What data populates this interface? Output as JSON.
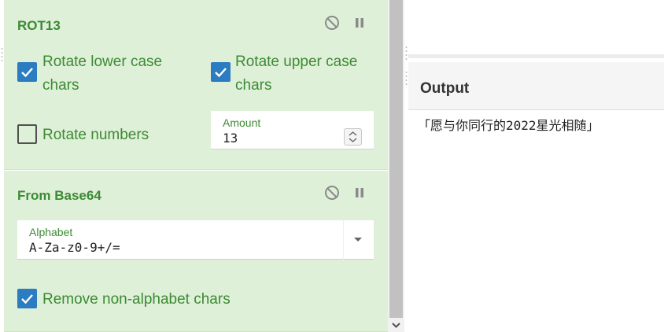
{
  "recipe": {
    "rot13": {
      "title": "ROT13",
      "rotate_lower_label": "Rotate lower case chars",
      "rotate_lower_line1": "Rotate lower case",
      "rotate_lower_line2": "chars",
      "rotate_lower_checked": true,
      "rotate_upper_line1": "Rotate upper case",
      "rotate_upper_line2": "chars",
      "rotate_upper_checked": true,
      "rotate_numbers_label": "Rotate numbers",
      "rotate_numbers_checked": false,
      "amount_label": "Amount",
      "amount_value": "13",
      "disable_icon": "disable-icon",
      "pause_icon": "pause-icon"
    },
    "from_base64": {
      "title": "From Base64",
      "alphabet_label": "Alphabet",
      "alphabet_value": "A-Za-z0-9+/=",
      "remove_non_alphabet_label": "Remove non-alphabet chars",
      "remove_non_alphabet_checked": true,
      "disable_icon": "disable-icon",
      "pause_icon": "pause-icon"
    }
  },
  "output": {
    "title": "Output",
    "text": "「愿与你同行的2022星光相随」"
  },
  "colors": {
    "operation_bg": "#dff0d8",
    "label_green": "#3c8a34",
    "checkbox_blue": "#2c7cc1"
  }
}
